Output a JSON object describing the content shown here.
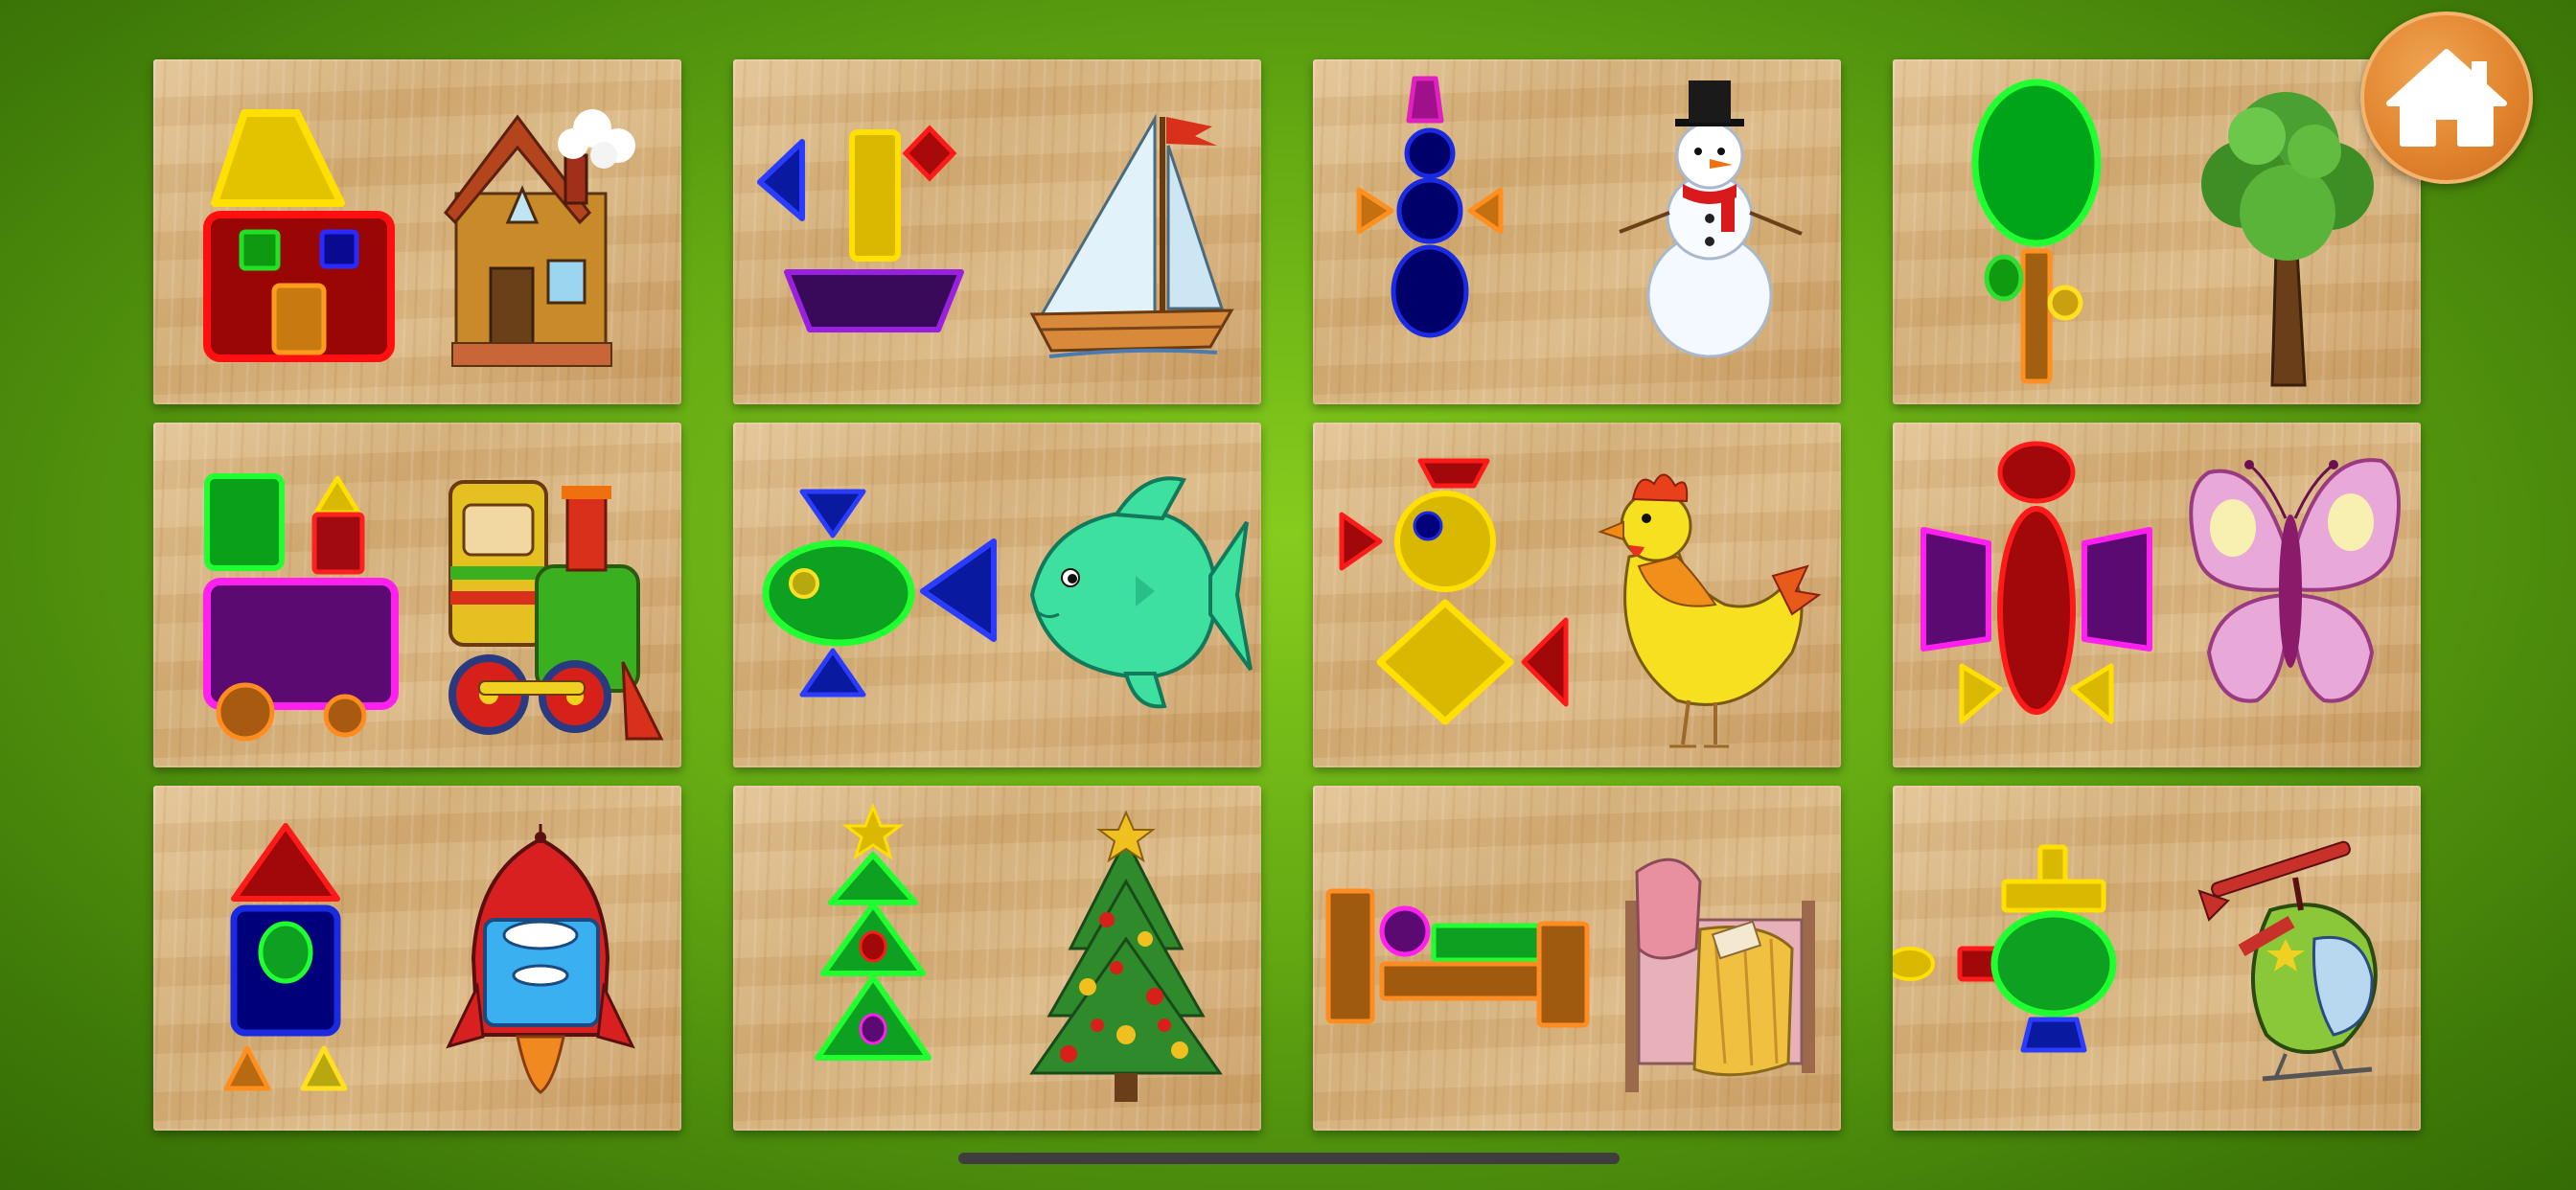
{
  "screen": "shape-puzzle-selection",
  "home_button": {
    "icon": "home-icon"
  },
  "puzzles": [
    {
      "id": "house",
      "icon": "house-icon"
    },
    {
      "id": "sailboat",
      "icon": "sailboat-icon"
    },
    {
      "id": "snowman",
      "icon": "snowman-icon"
    },
    {
      "id": "tree",
      "icon": "tree-icon"
    },
    {
      "id": "train",
      "icon": "train-icon"
    },
    {
      "id": "fish",
      "icon": "fish-icon"
    },
    {
      "id": "chicken",
      "icon": "chicken-icon"
    },
    {
      "id": "butterfly",
      "icon": "butterfly-icon"
    },
    {
      "id": "rocket",
      "icon": "rocket-icon"
    },
    {
      "id": "christmas-tree",
      "icon": "christmas-tree-icon"
    },
    {
      "id": "bed",
      "icon": "bed-icon"
    },
    {
      "id": "helicopter",
      "icon": "helicopter-icon"
    }
  ],
  "colors": {
    "background": "#6bb516",
    "home_button": "#e0822c",
    "card_wood": "#d8b47e"
  }
}
